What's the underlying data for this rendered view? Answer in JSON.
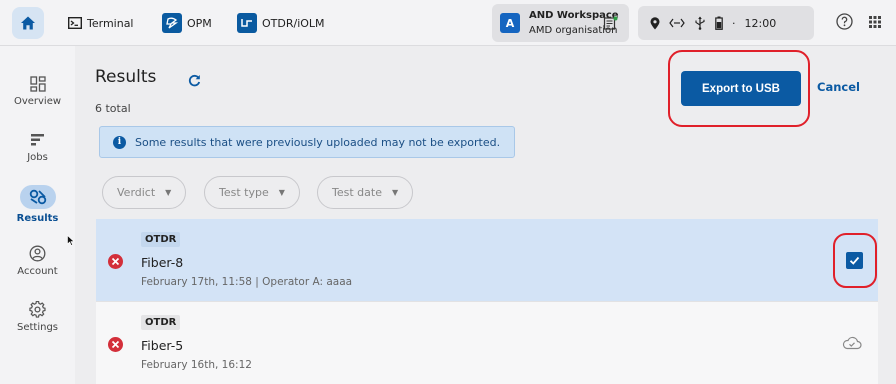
{
  "topbar": {
    "home_icon": "home-icon",
    "tabs": [
      {
        "label": "Terminal",
        "icon": "terminal-icon"
      },
      {
        "label": "OPM",
        "icon": "power-meter-icon"
      },
      {
        "label": "OTDR/iOLM",
        "icon": "otdr-icon"
      }
    ],
    "workspace": {
      "avatar": "A",
      "title": "AND Workspace",
      "subtitle": "AMD organisation",
      "icon": "note-icon"
    },
    "status": {
      "separator": "·",
      "time": "12:00",
      "icons": [
        "location-icon",
        "network-icon",
        "usb-icon",
        "battery-icon"
      ]
    },
    "help_icon": "help-icon",
    "apps_icon": "apps-grid-icon"
  },
  "sidebar": {
    "items": [
      {
        "label": "Overview",
        "icon": "overview-icon",
        "active": false
      },
      {
        "label": "Jobs",
        "icon": "jobs-icon",
        "active": false
      },
      {
        "label": "Results",
        "icon": "results-icon",
        "active": true
      },
      {
        "label": "Account",
        "icon": "account-icon",
        "active": false
      },
      {
        "label": "Settings",
        "icon": "gear-icon",
        "active": false
      }
    ]
  },
  "main": {
    "title": "Results",
    "total": "6 total",
    "export_label": "Export to USB",
    "cancel_label": "Cancel",
    "info_message": "Some results that were previously uploaded may not be exported.",
    "filters": [
      {
        "label": "Verdict"
      },
      {
        "label": "Test type"
      },
      {
        "label": "Test date"
      }
    ],
    "results": [
      {
        "type": "OTDR",
        "name": "Fiber-8",
        "meta": "February 17th, 11:58  | Operator A: aaaa",
        "verdict": "fail",
        "selected": true
      },
      {
        "type": "OTDR",
        "name": "Fiber-5",
        "meta": "February 16th, 16:12",
        "verdict": "fail",
        "selected": false,
        "status_icon": "cloud-check-icon"
      }
    ]
  },
  "colors": {
    "accent": "#0b5aa3",
    "selected_row": "#d3e3f6",
    "error": "#d32f3a",
    "highlight": "#e0202a"
  }
}
